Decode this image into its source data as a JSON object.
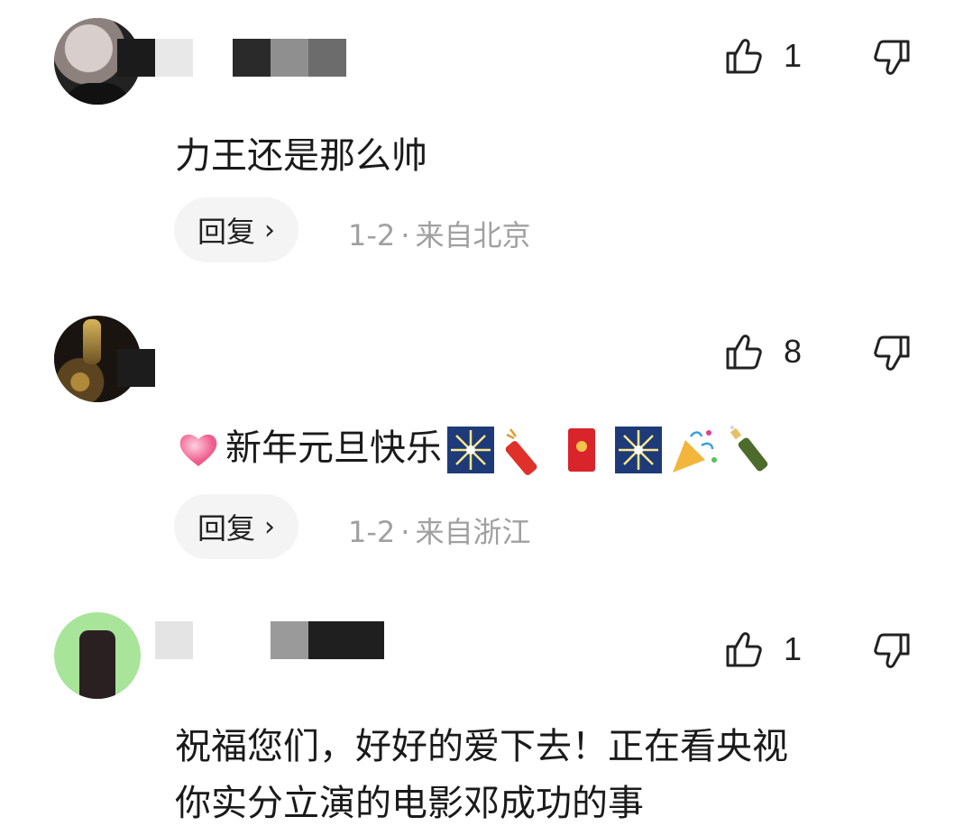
{
  "comments": [
    {
      "text": "力王还是那么帅",
      "likes": "1",
      "reply_label": "回复",
      "date": "1-2",
      "separator": "·",
      "location": "来自北京"
    },
    {
      "text": "新年元旦快乐",
      "likes": "8",
      "reply_label": "回复",
      "date": "1-2",
      "separator": "·",
      "location": "来自浙江",
      "emojis": [
        "pink-heart",
        "fireworks",
        "firecracker",
        "red-envelope",
        "fireworks",
        "party-popper",
        "champagne"
      ]
    },
    {
      "text": "祝福您们，好好的爱下去！正在看央视",
      "text_line2": "你实分立演的电影邓成功的事",
      "likes": "1"
    }
  ],
  "icons": {
    "like": "thumbs-up-outline-icon",
    "dislike": "thumbs-down-outline-icon",
    "reply_chevron": "chevron-right-icon"
  },
  "colors": {
    "reply_pill_bg": "#f4f4f4",
    "meta_text": "#a0a0a0",
    "body_text": "#1a1a1a"
  }
}
